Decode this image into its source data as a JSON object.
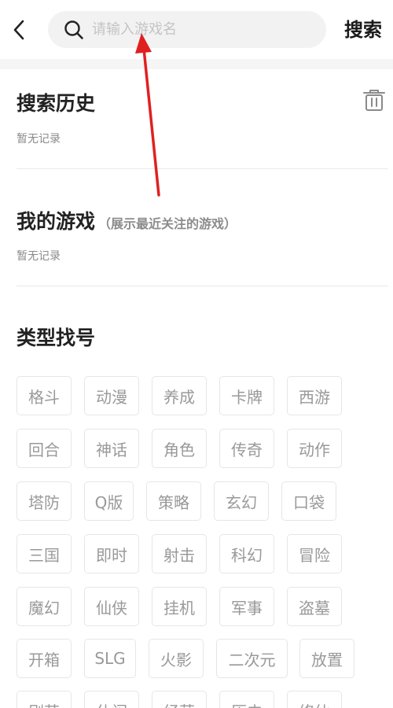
{
  "header": {
    "search_placeholder": "请输入游戏名",
    "search_button": "搜索"
  },
  "history": {
    "title": "搜索历史",
    "empty_text": "暂无记录"
  },
  "my_games": {
    "title": "我的游戏",
    "subtitle": "（展示最近关注的游戏）",
    "empty_text": "暂无记录"
  },
  "categories": {
    "title": "类型找号",
    "tags": [
      "格斗",
      "动漫",
      "养成",
      "卡牌",
      "西游",
      "回合",
      "神话",
      "角色",
      "传奇",
      "动作",
      "塔防",
      "Q版",
      "策略",
      "玄幻",
      "口袋",
      "三国",
      "即时",
      "射击",
      "科幻",
      "冒险",
      "魔幻",
      "仙侠",
      "挂机",
      "军事",
      "盗墓",
      "开箱",
      "SLG",
      "火影",
      "二次元",
      "放置",
      "剧萌",
      "休闲",
      "经营",
      "历史",
      "修仙"
    ]
  },
  "colors": {
    "annotation_arrow": "#e02020"
  }
}
